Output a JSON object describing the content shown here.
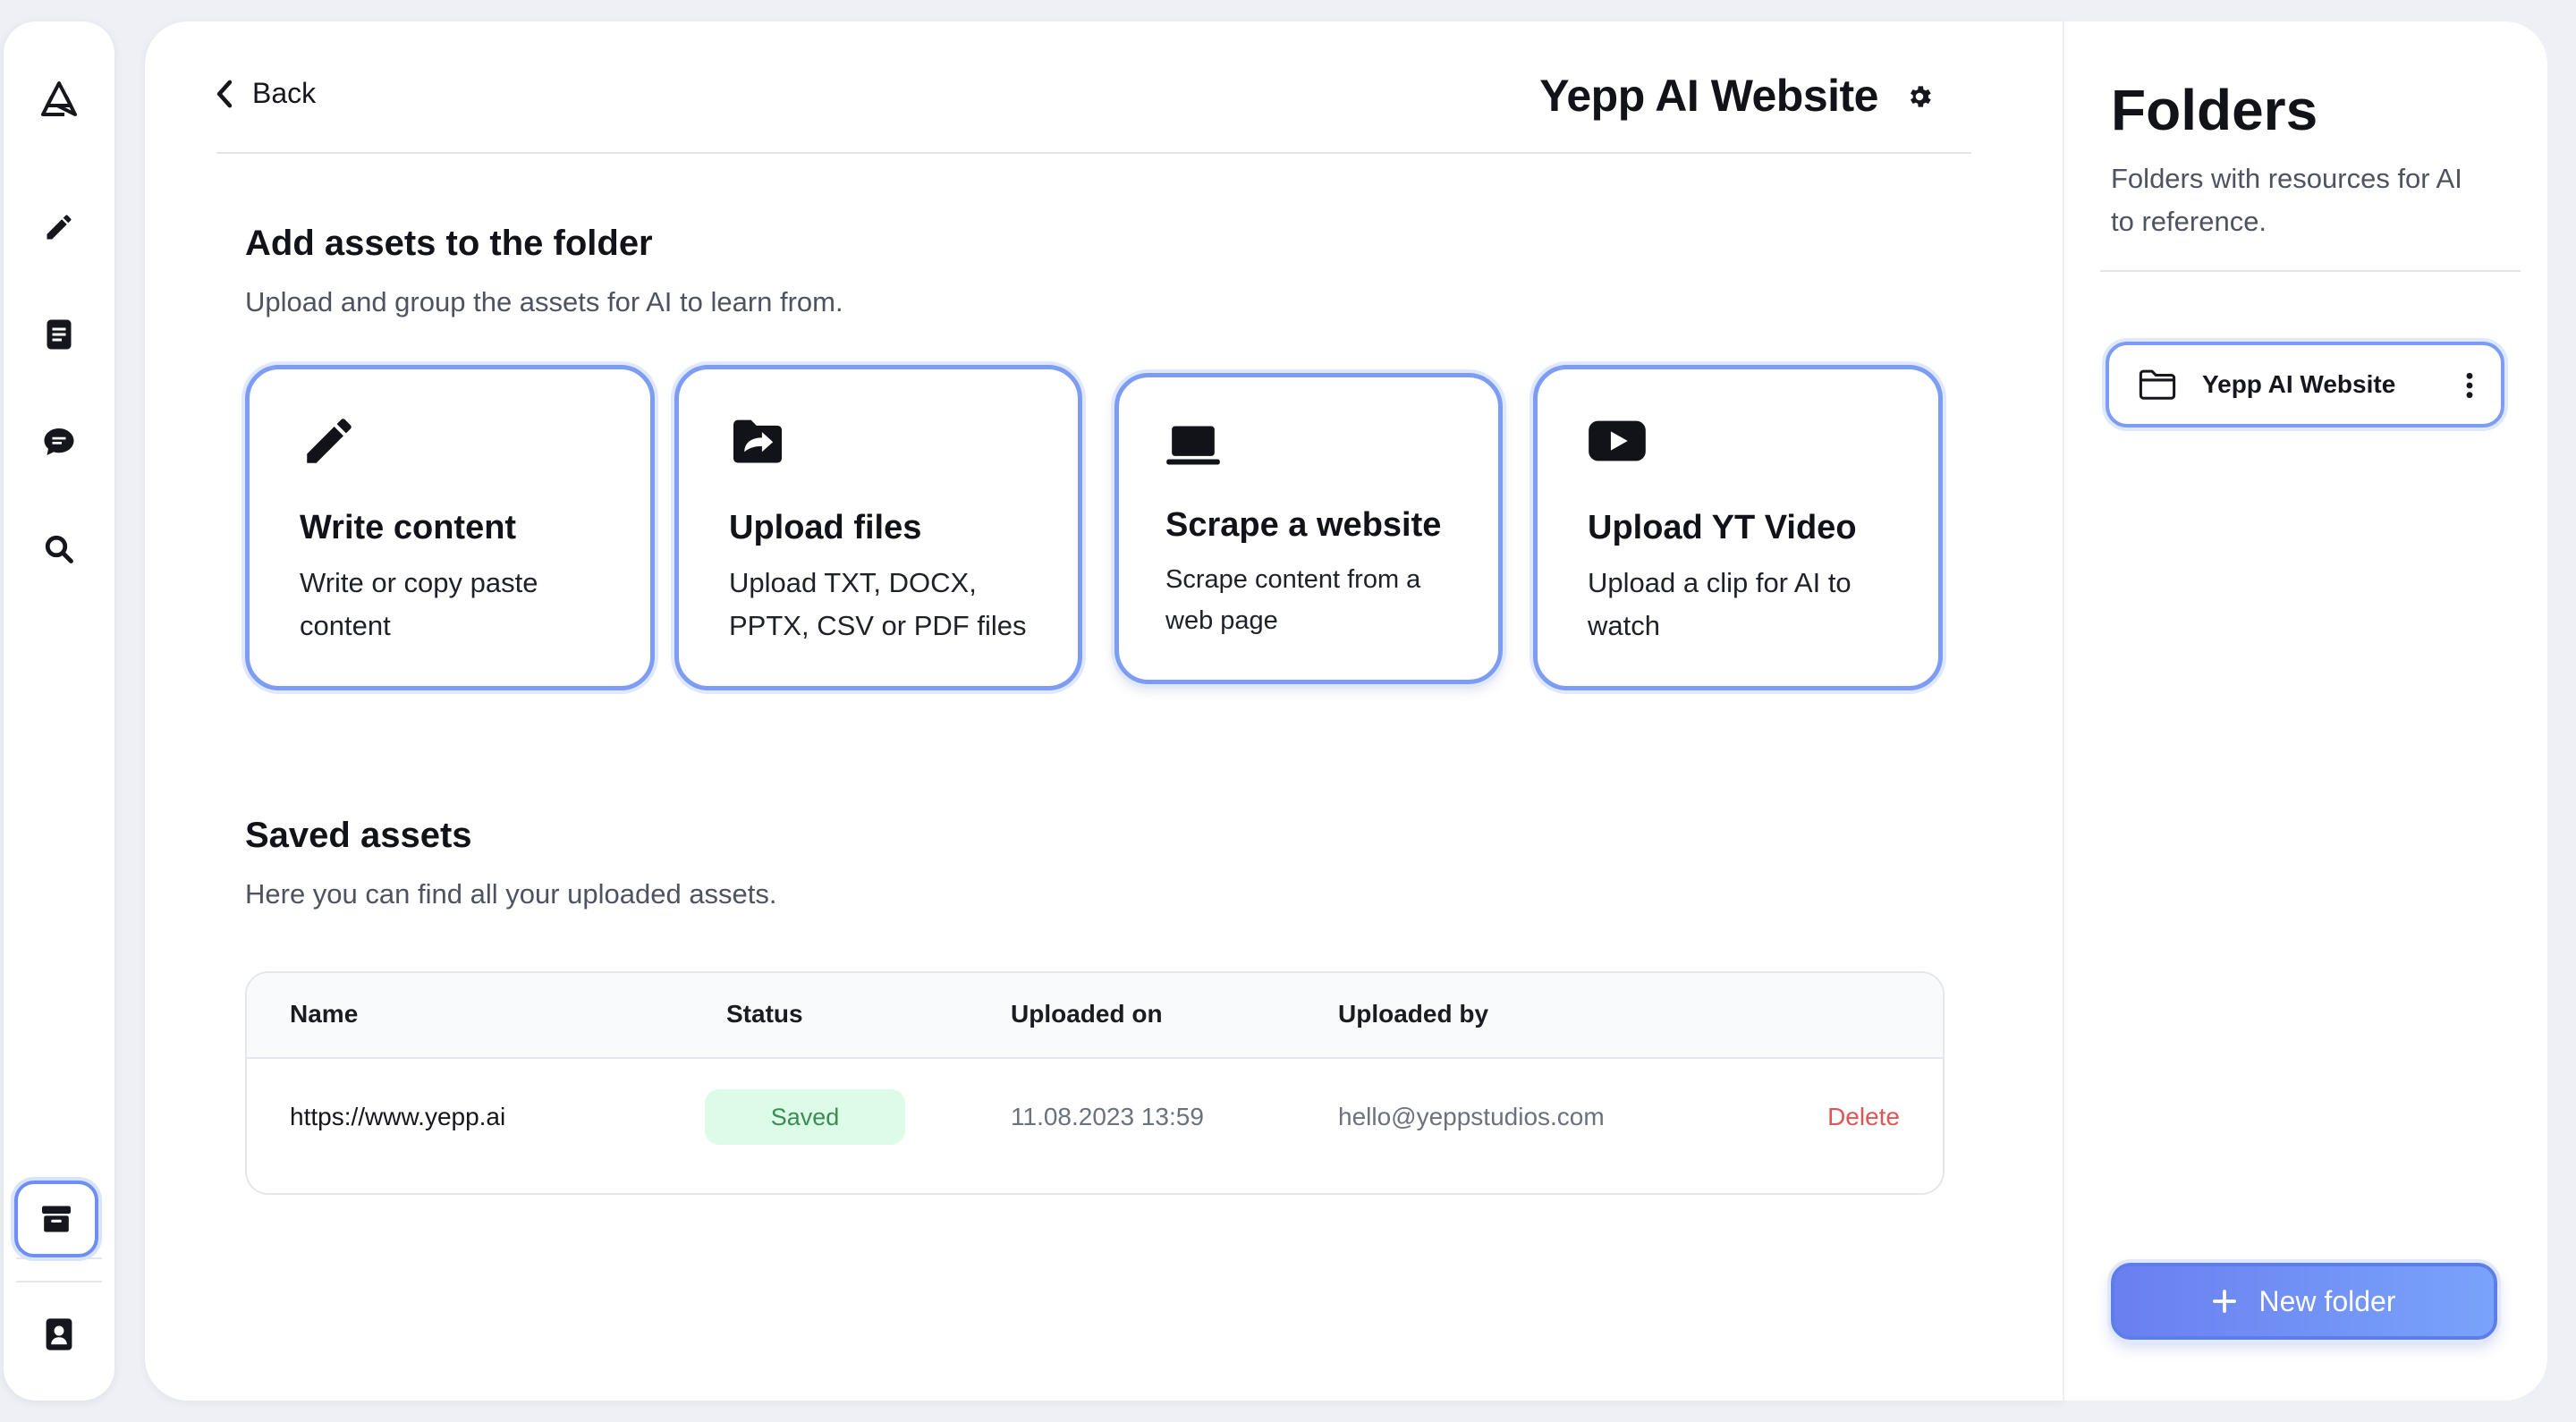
{
  "header": {
    "back_label": "Back",
    "page_title": "Yepp AI Website"
  },
  "sidebar": {
    "items": [
      {
        "icon": "logo-icon"
      },
      {
        "icon": "pencil-icon"
      },
      {
        "icon": "document-icon"
      },
      {
        "icon": "chat-icon"
      },
      {
        "icon": "search-icon"
      },
      {
        "icon": "archive-icon",
        "active": true
      },
      {
        "icon": "contact-book-icon"
      }
    ]
  },
  "add_assets": {
    "title": "Add assets to the folder",
    "subtitle": "Upload and group the assets for AI to learn from.",
    "cards": [
      {
        "icon": "pencil-icon",
        "title": "Write content",
        "desc_1": "Write or copy paste",
        "desc_2": "content"
      },
      {
        "icon": "folder-upload-icon",
        "title": "Upload files",
        "desc_1": "Upload TXT, DOCX,",
        "desc_2": "PPTX, CSV or PDF files"
      },
      {
        "icon": "laptop-icon",
        "title": "Scrape a website",
        "desc_1": "Scrape content from a",
        "desc_2": "web page"
      },
      {
        "icon": "youtube-icon",
        "title": "Upload YT Video",
        "desc_1": "Upload a clip for AI to",
        "desc_2": "watch"
      }
    ]
  },
  "saved_assets": {
    "title": "Saved assets",
    "subtitle": "Here you can find all your uploaded assets.",
    "columns": [
      "Name",
      "Status",
      "Uploaded on",
      "Uploaded by"
    ],
    "rows": [
      {
        "name": "https://www.yepp.ai",
        "status": "Saved",
        "uploaded_on": "11.08.2023 13:59",
        "uploaded_by": "hello@yeppstudios.com",
        "action": "Delete"
      }
    ]
  },
  "folders_panel": {
    "title": "Folders",
    "subtitle": "Folders with resources for AI to reference.",
    "items": [
      {
        "name": "Yepp AI Website",
        "icon": "folder-icon"
      }
    ],
    "new_folder_label": "New folder"
  },
  "colors": {
    "accent": "#7d9cf3",
    "button_gradient_start": "#6a7ff0",
    "button_gradient_end": "#79a3fb",
    "status_saved_bg": "#dcfce7",
    "status_saved_text": "#3a8c52",
    "delete_text": "#e05555"
  }
}
